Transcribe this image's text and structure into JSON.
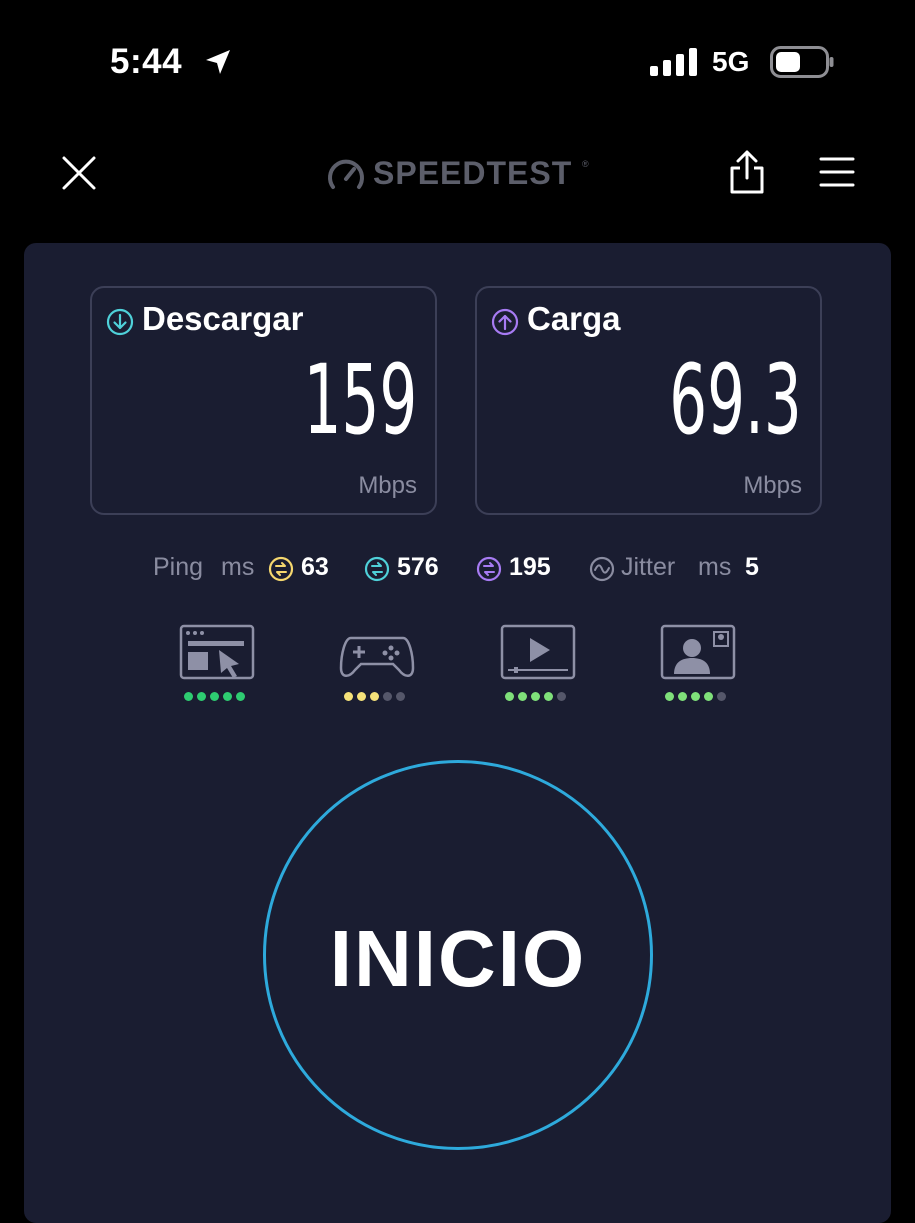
{
  "status_bar": {
    "time": "5:44",
    "network": "5G",
    "icons": [
      "location-arrow-icon",
      "signal-bars-icon",
      "battery-icon"
    ]
  },
  "header": {
    "logo_text": "SPEEDTEST",
    "logo_mark": "®",
    "icons": [
      "close-icon",
      "speedometer-icon",
      "share-icon",
      "menu-icon"
    ]
  },
  "download": {
    "label": "Descargar",
    "value": "159",
    "unit": "Mbps",
    "icon": "arrow-down-circle-icon",
    "color": "#4fd1d9"
  },
  "upload": {
    "label": "Carga",
    "value": "69.3",
    "unit": "Mbps",
    "icon": "arrow-up-circle-icon",
    "color": "#a77bf3"
  },
  "ping": {
    "label": "Ping",
    "unit": "ms",
    "idle": {
      "value": "63",
      "color": "#f5d76e"
    },
    "download": {
      "value": "576",
      "color": "#4fd1d9"
    },
    "upload": {
      "value": "195",
      "color": "#a77bf3"
    }
  },
  "jitter": {
    "label": "Jitter",
    "unit": "ms",
    "value": "5"
  },
  "quality": [
    {
      "icon": "web-browsing-icon",
      "rating": 5,
      "max": 5,
      "color": "#2ecc71"
    },
    {
      "icon": "gaming-controller-icon",
      "rating": 3,
      "max": 5,
      "color": "#f5e27a"
    },
    {
      "icon": "video-streaming-icon",
      "rating": 4,
      "max": 5,
      "color": "#7fe07a"
    },
    {
      "icon": "video-call-icon",
      "rating": 4,
      "max": 5,
      "color": "#7fe07a"
    }
  ],
  "go_button": {
    "label": "INICIO",
    "color": "#2eaadc"
  }
}
